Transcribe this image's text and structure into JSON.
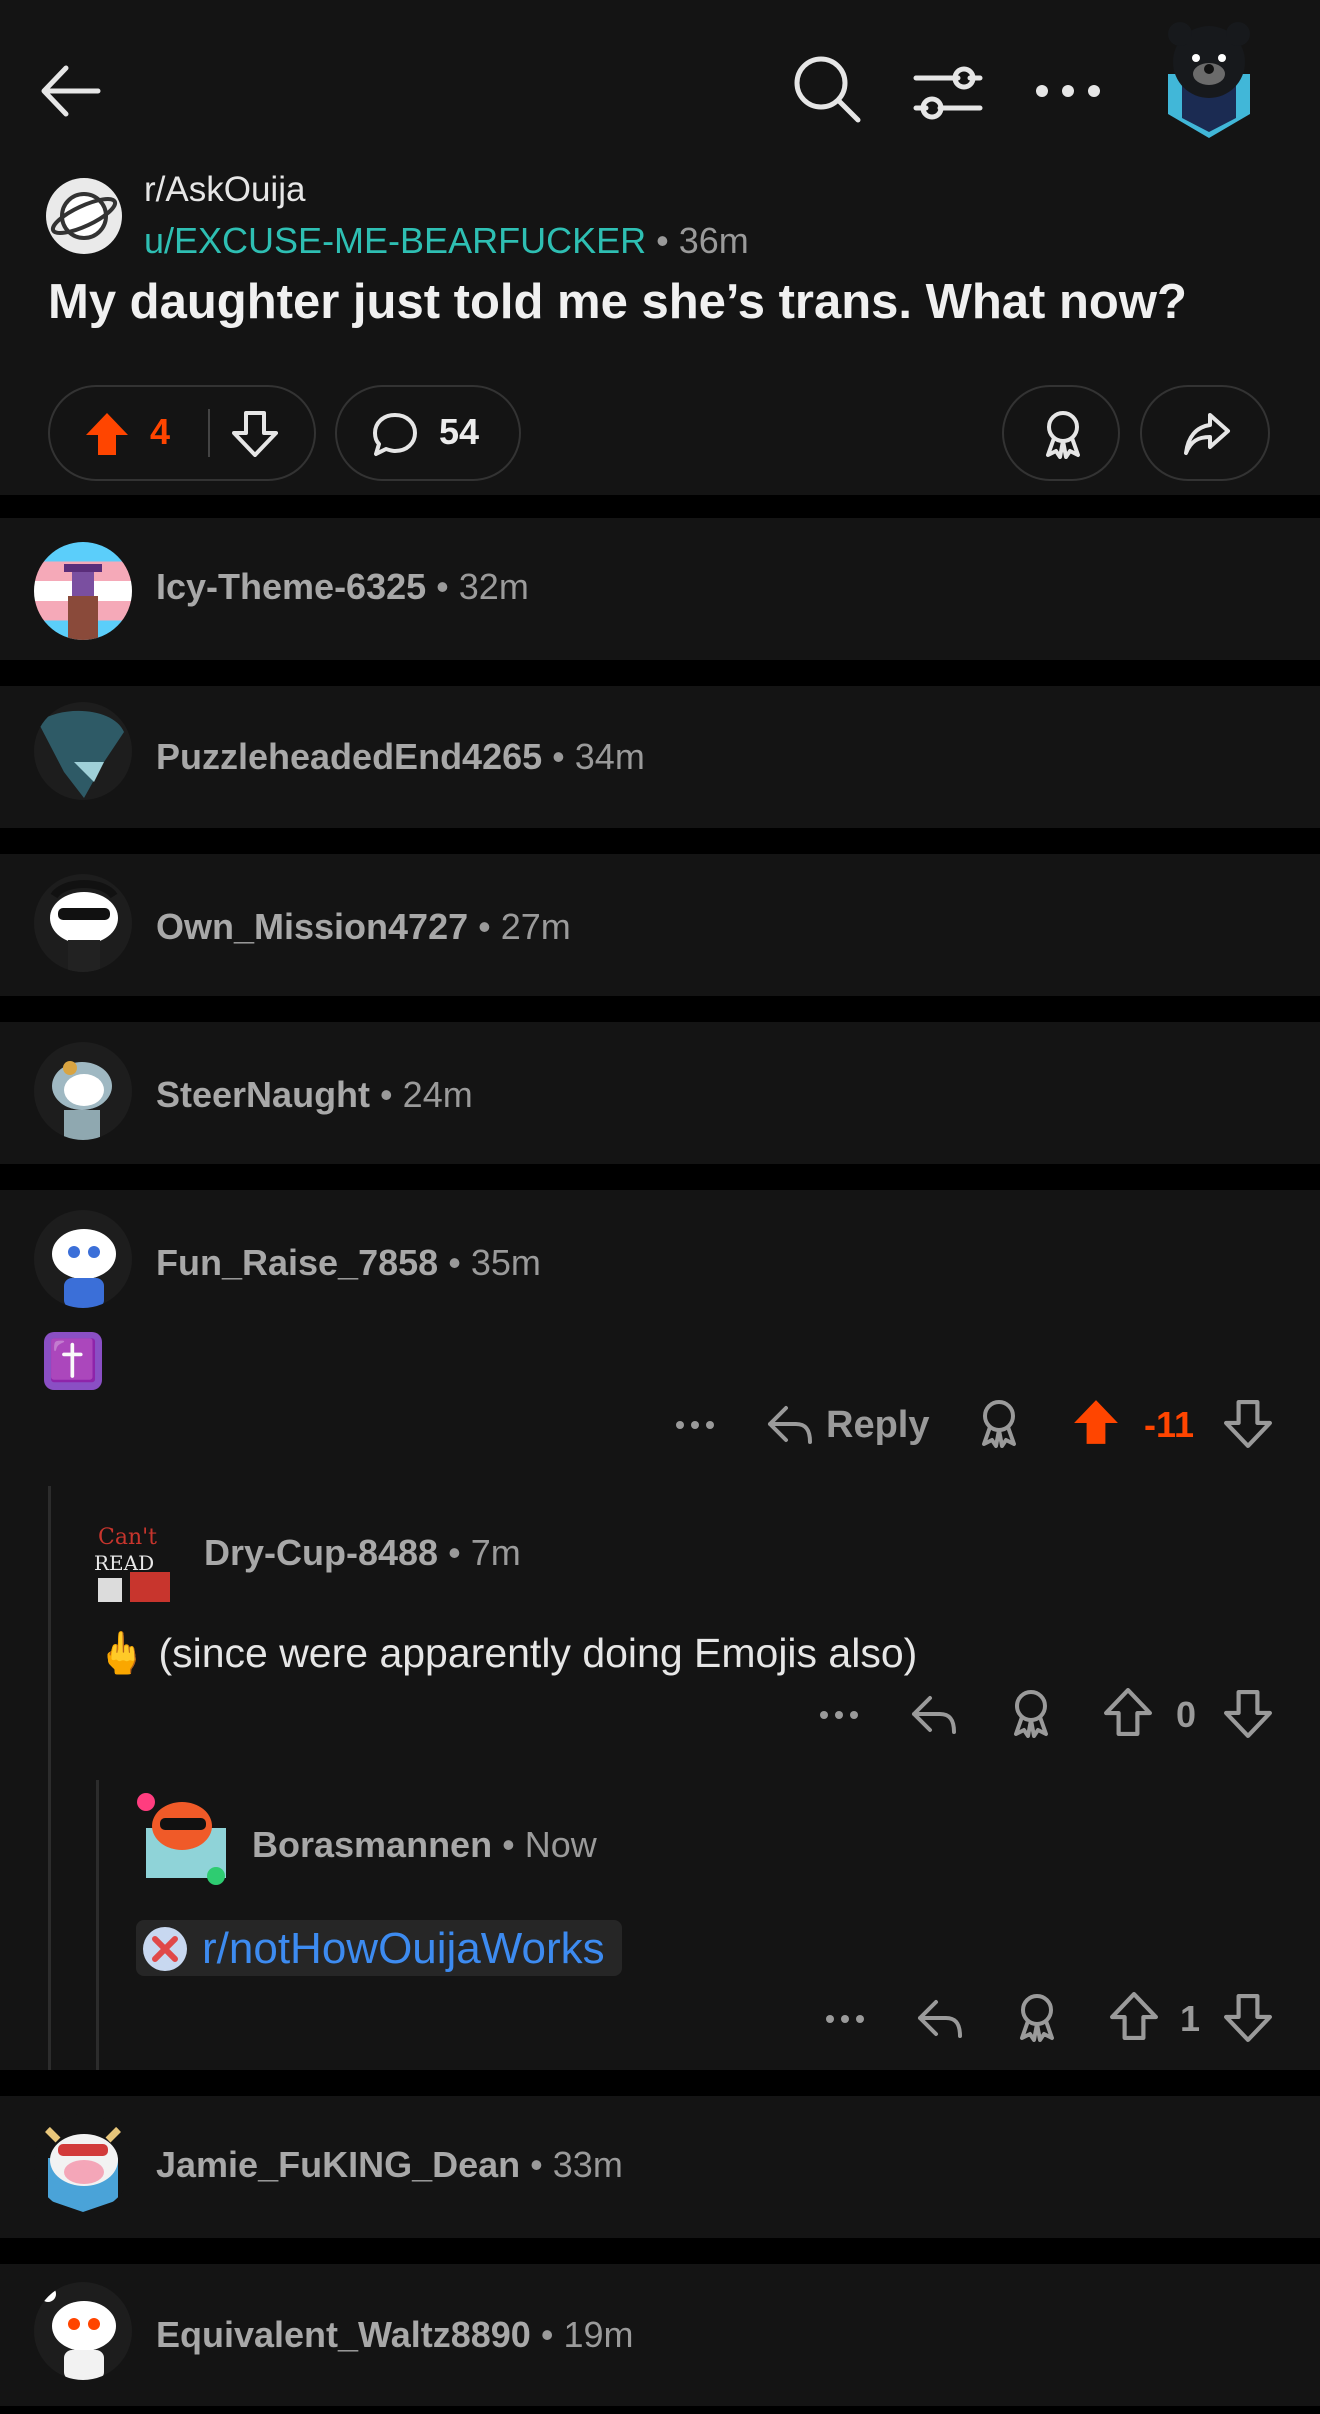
{
  "header": {
    "back_icon": "arrow-left-icon",
    "search_icon": "search-icon",
    "filter_icon": "sort-filter-icon",
    "more_icon": "ellipsis-icon",
    "avatar": "bear-avatar"
  },
  "post": {
    "subreddit": "r/AskOuija",
    "author": "u/EXCUSE-ME-BEARFUCKER",
    "separator": "•",
    "age": "36m",
    "title": "My daughter just told me she’s trans. What now?",
    "votes": "4",
    "comments": "54"
  },
  "comments": [
    {
      "user": "Icy-Theme-6325",
      "age": "32m",
      "collapsed": true
    },
    {
      "user": "PuzzleheadedEnd4265",
      "age": "34m",
      "collapsed": true
    },
    {
      "user": "Own_Mission4727",
      "age": "27m",
      "collapsed": true
    },
    {
      "user": "SteerNaught",
      "age": "24m",
      "collapsed": true
    },
    {
      "user": "Fun_Raise_7858",
      "age": "35m",
      "body_emoji": "✝️",
      "reply_label": "Reply",
      "score": "-11",
      "replies": [
        {
          "user": "Dry-Cup-8488",
          "age": "7m",
          "body": "🖕 (since were apparently doing Emojis also)",
          "score": "0",
          "replies": [
            {
              "user": "Borasmannen",
              "age": "Now",
              "body_link": "r/notHowOuijaWorks",
              "score": "1"
            }
          ]
        }
      ]
    },
    {
      "user": "Jamie_FuKING_Dean",
      "age": "33m",
      "collapsed": true
    },
    {
      "user": "Equivalent_Waltz8890",
      "age": "19m",
      "collapsed": true
    }
  ],
  "colors": {
    "upvote": "#ff4500",
    "author": "#2ebfb3",
    "link": "#3d8bf0",
    "background": "#141414"
  }
}
